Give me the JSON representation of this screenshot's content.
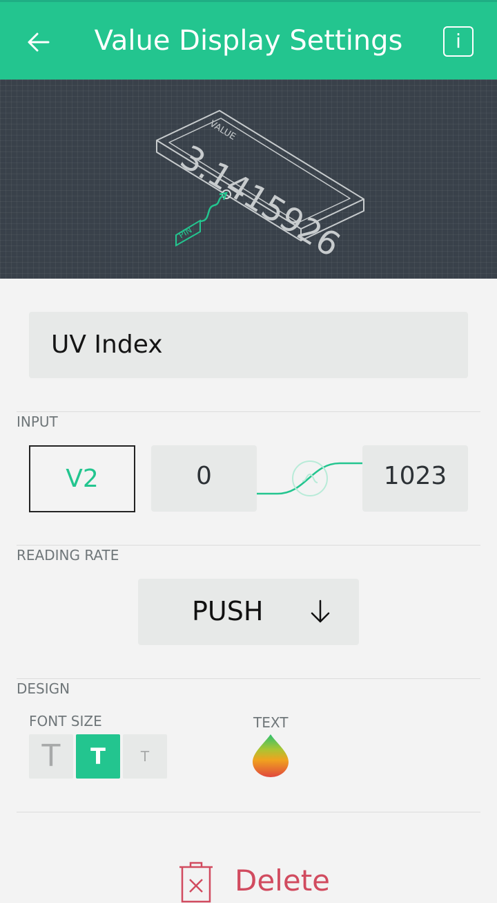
{
  "header": {
    "title": "Value Display Settings",
    "back_icon": "arrow-left-icon",
    "info_label": "i"
  },
  "preview": {
    "value_label": "VALUE",
    "value": "3.1415926",
    "pin_label": "PIN"
  },
  "name_field": {
    "value": "UV Index"
  },
  "input": {
    "section_label": "INPUT",
    "pin": "V2",
    "min": "0",
    "max": "1023"
  },
  "reading_rate": {
    "section_label": "READING RATE",
    "selected": "PUSH",
    "arrow_icon": "arrow-down-icon"
  },
  "design": {
    "section_label": "DESIGN",
    "font_size_label": "FONT SIZE",
    "font_sizes": [
      "T",
      "T",
      "T"
    ],
    "selected_font_size_index": 1,
    "text_color_label": "TEXT"
  },
  "actions": {
    "delete_label": "Delete",
    "delete_icon": "trash-icon"
  },
  "colors": {
    "accent": "#23c58f",
    "header_bg": "#23c58f",
    "preview_bg": "#39414a",
    "field_bg": "#e7e9e8",
    "delete": "#d14b5f"
  }
}
